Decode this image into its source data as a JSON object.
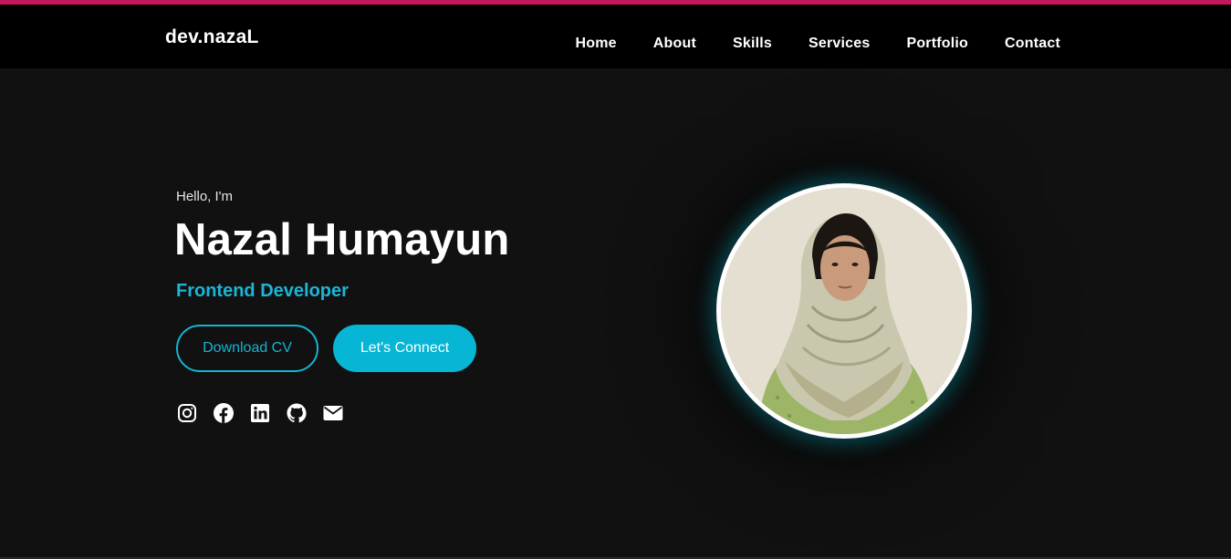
{
  "header": {
    "logo": "dev.nazaL",
    "nav": [
      {
        "label": "Home"
      },
      {
        "label": "About"
      },
      {
        "label": "Skills"
      },
      {
        "label": "Services"
      },
      {
        "label": "Portfolio"
      },
      {
        "label": "Contact"
      }
    ]
  },
  "hero": {
    "greeting": "Hello, I'm",
    "name": "Nazal Humayun",
    "role": "Frontend Developer",
    "buttons": {
      "download_cv": "Download CV",
      "connect": "Let's Connect"
    },
    "socials": [
      {
        "icon": "instagram-icon"
      },
      {
        "icon": "facebook-icon"
      },
      {
        "icon": "linkedin-icon"
      },
      {
        "icon": "github-icon"
      },
      {
        "icon": "envelope-icon"
      }
    ],
    "photo": {
      "icon": "profile-photo"
    }
  },
  "colors": {
    "accent": "#06b6d4",
    "top_stripe": "#c2185b",
    "background": "#111111",
    "navbar": "#000000"
  }
}
